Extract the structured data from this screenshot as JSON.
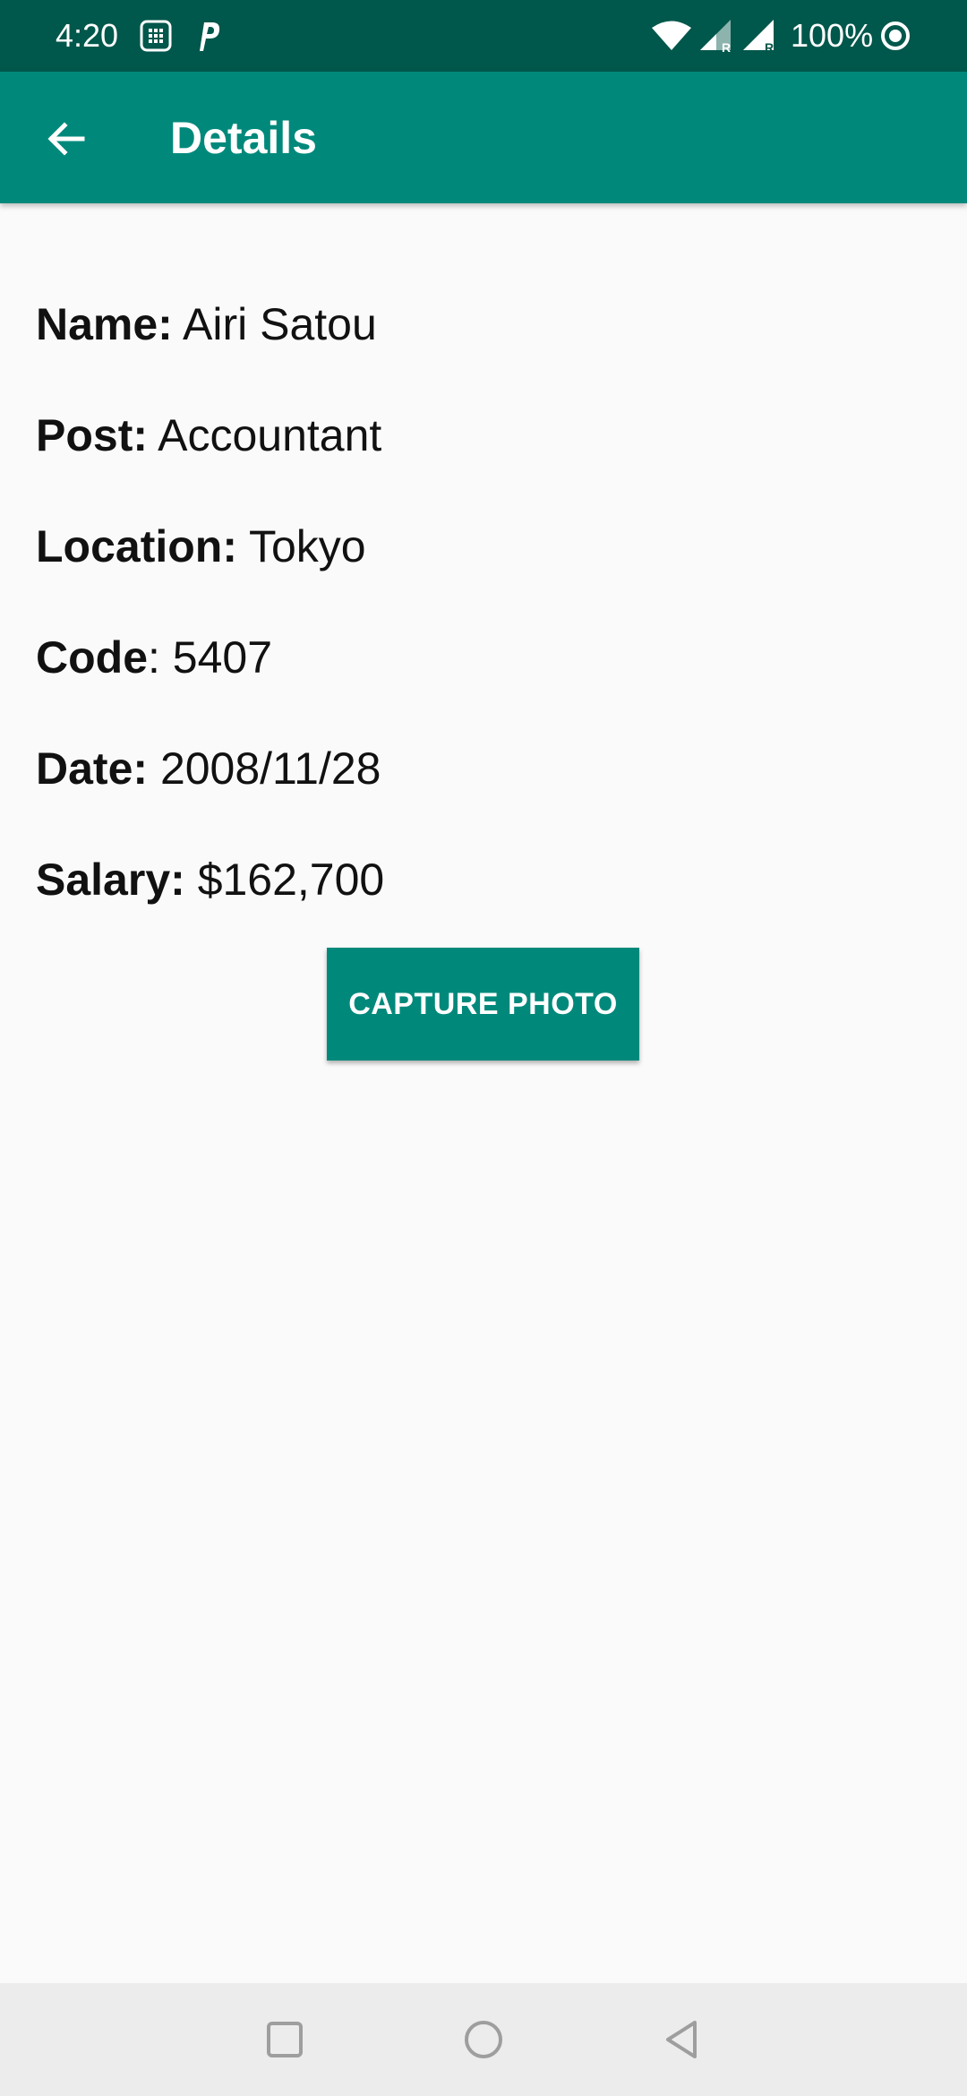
{
  "status_bar": {
    "time": "4:20",
    "battery_percent": "100%",
    "icons": [
      "sim-card-icon",
      "parking-app-icon",
      "wifi-icon",
      "signal-r-icon",
      "signal-r-icon",
      "battery-ring-icon"
    ]
  },
  "app_bar": {
    "title": "Details",
    "back_icon": "arrow-back-icon"
  },
  "details": [
    {
      "label": "Name:",
      "value": "Airi Satou"
    },
    {
      "label": "Post:",
      "value": "Accountant"
    },
    {
      "label": "Location:",
      "value": "Tokyo"
    },
    {
      "label": "Code",
      "value": ": 5407"
    },
    {
      "label": "Date:",
      "value": "2008/11/28"
    },
    {
      "label": "Salary:",
      "value": "$162,700"
    }
  ],
  "actions": {
    "capture_label": "CAPTURE PHOTO"
  },
  "nav_bar": {
    "icons": [
      "recents-square-icon",
      "home-circle-icon",
      "back-triangle-icon"
    ]
  },
  "colors": {
    "status_bar": "#00574b",
    "primary": "#00897b",
    "background": "#fafafa",
    "nav_bar": "#ececec"
  }
}
